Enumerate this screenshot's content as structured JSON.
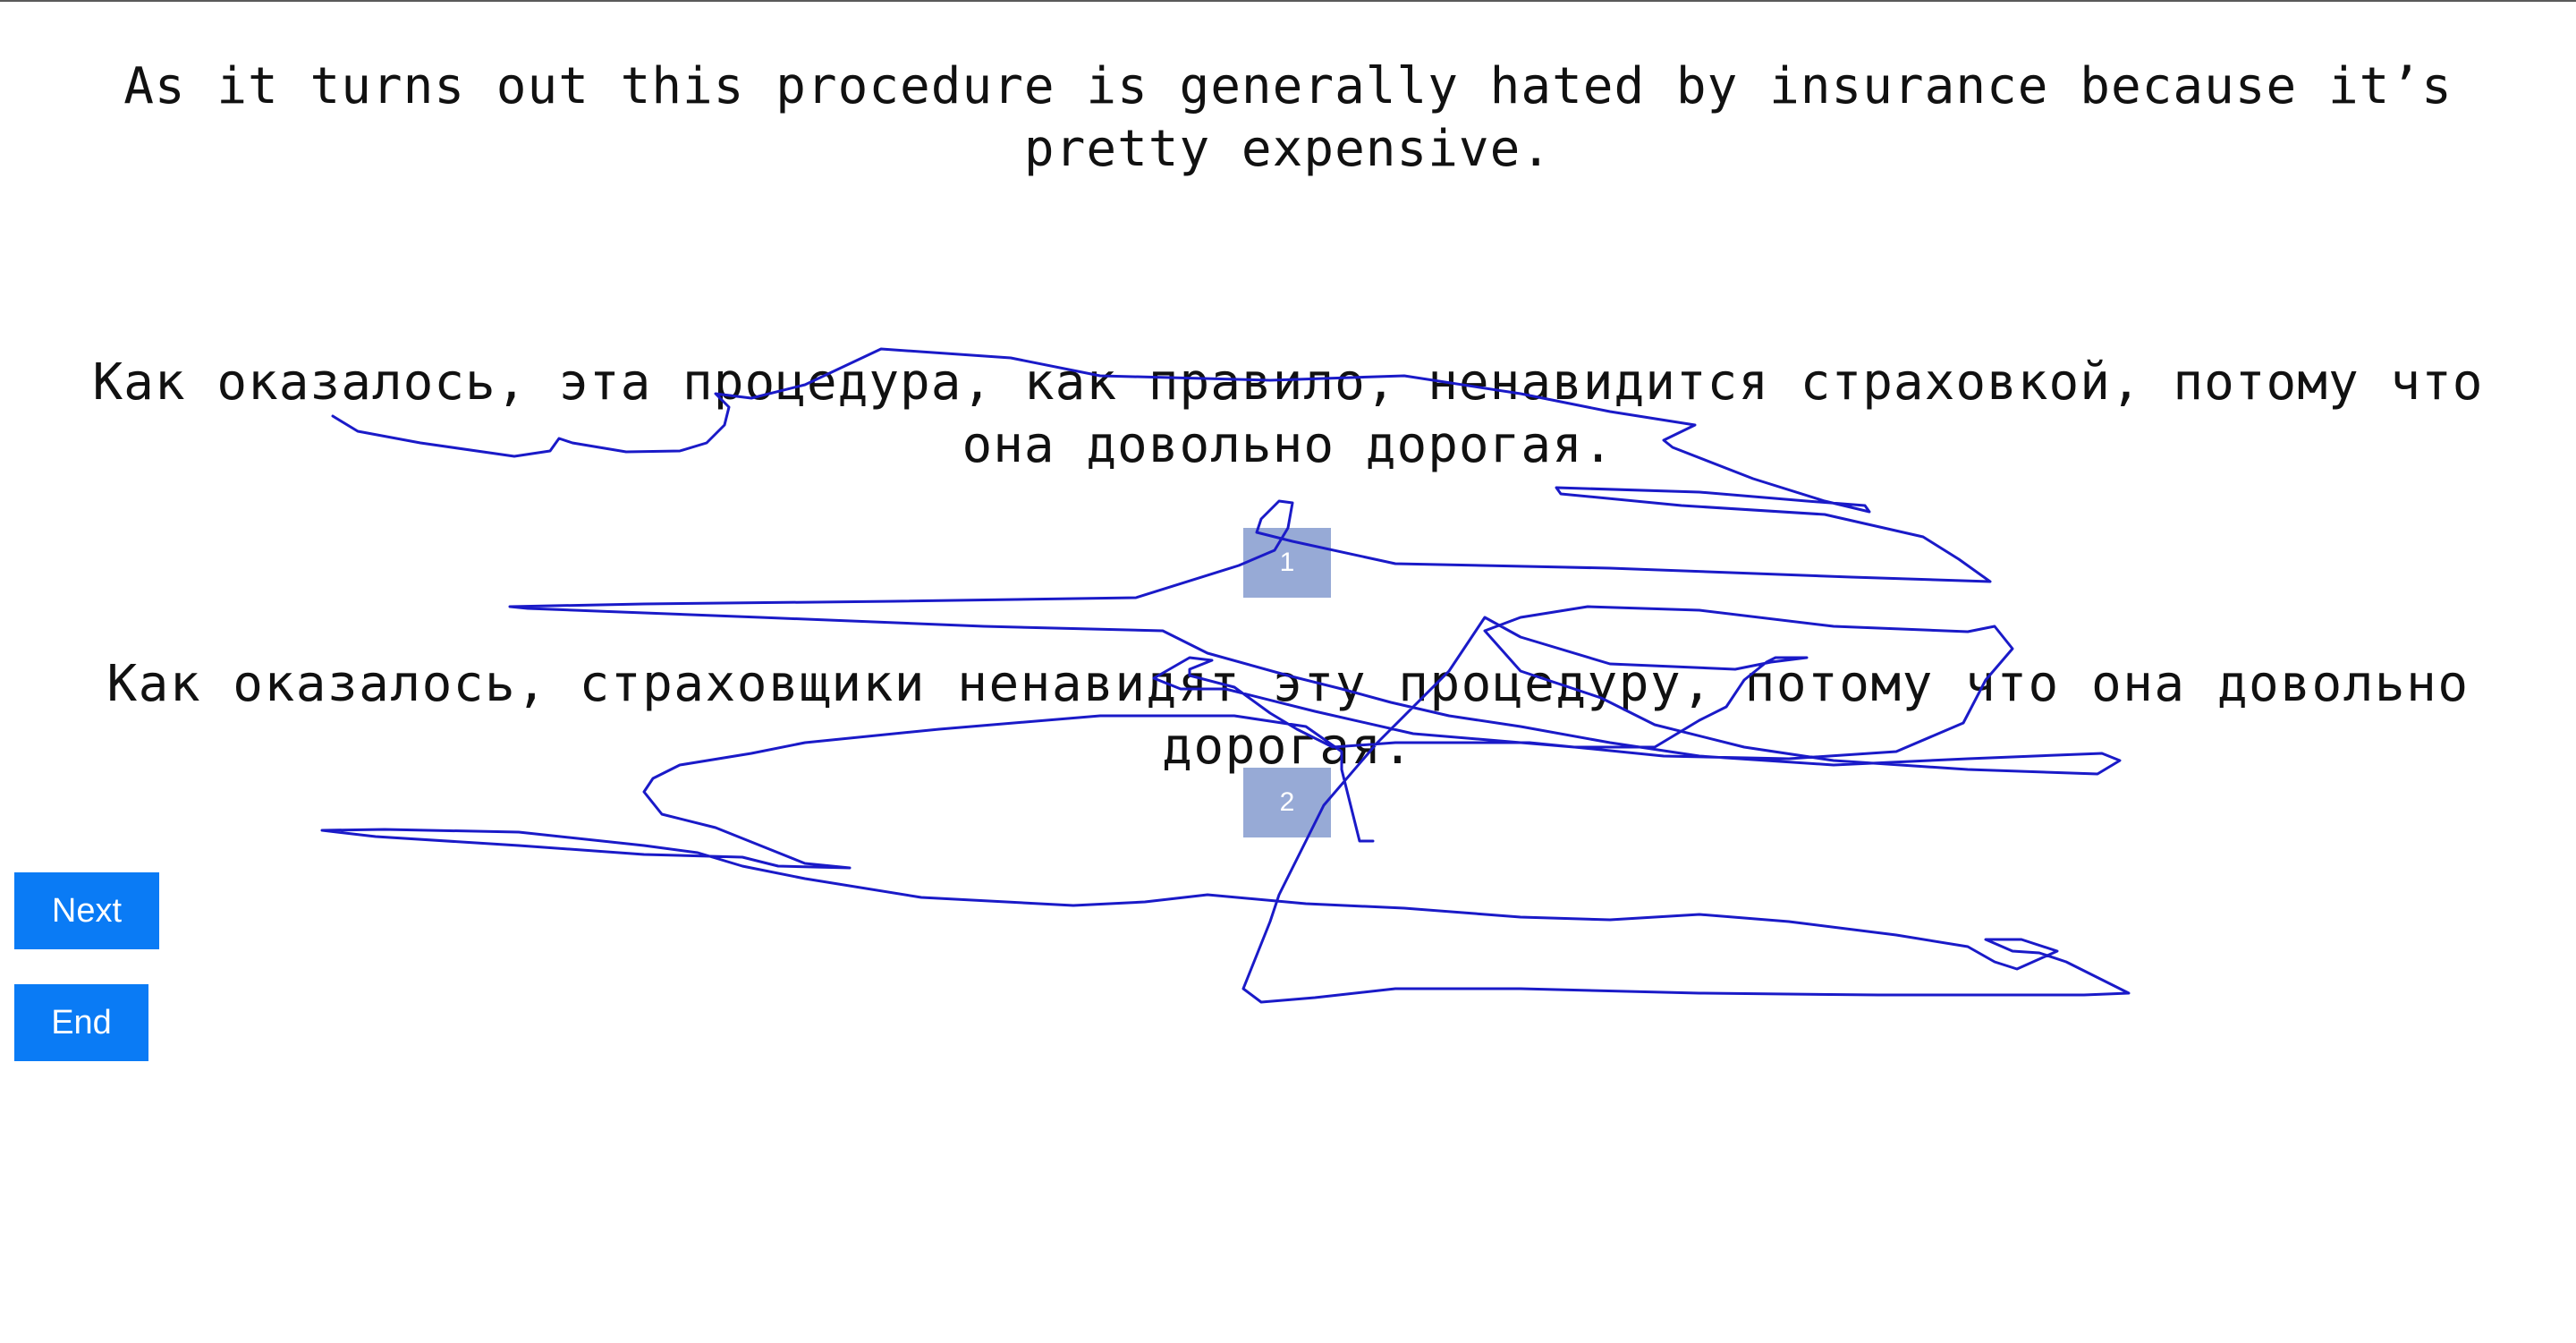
{
  "source": {
    "text": "As it turns out this procedure is generally hated by insurance because it’s pretty expensive."
  },
  "translations": [
    {
      "tag": "1",
      "text": "Как оказалось, эта процедура, как правило, ненавидится страховкой, потому что она довольно дорогая."
    },
    {
      "tag": "2",
      "text": "Как оказалось, страховщики ненавидят эту процедуру, потому что она довольно дорогая."
    }
  ],
  "buttons": {
    "next_label": "Next",
    "end_label": "End"
  },
  "colors": {
    "button": "#0a7bf5",
    "tag": "#97aad6",
    "scribble": "#1a1ac8"
  }
}
